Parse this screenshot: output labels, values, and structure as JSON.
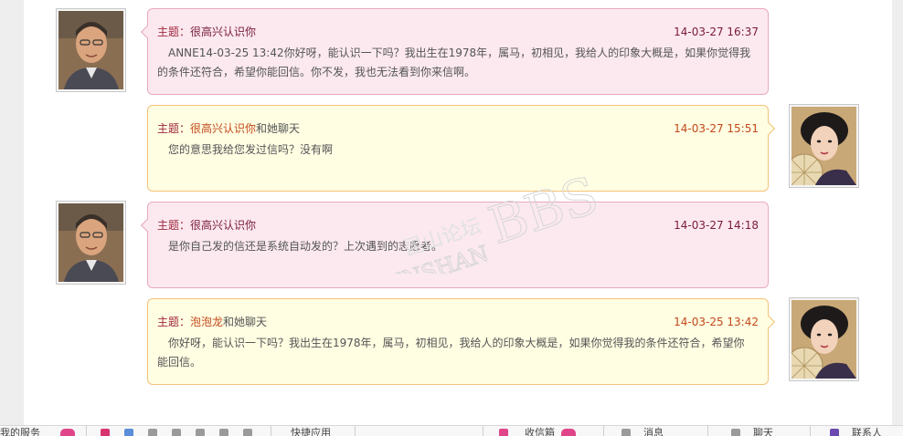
{
  "messages": [
    {
      "side": "left",
      "style": "pink",
      "subject_label": "主题：",
      "topic": "很高兴认识你",
      "suffix": "",
      "time": "14-03-27 16:37",
      "body": "ANNE14-03-25 13:42你好呀，能认识一下吗？我出生在1978年，属马，初相见，我给人的印象大概是，如果你觉得我的条件还符合，希望你能回信。你不发，我也无法看到你来信啊。",
      "avatar": "male-avatar"
    },
    {
      "side": "right",
      "style": "yellow",
      "subject_label": "主题：",
      "topic": "很高兴认识你",
      "suffix": "和她聊天",
      "time": "14-03-27 15:51",
      "body": "您的意思我给您发过信吗？没有啊",
      "avatar": "female-avatar"
    },
    {
      "side": "left",
      "style": "pink",
      "subject_label": "主题：",
      "topic": "很高兴认识你",
      "suffix": "",
      "time": "14-03-27 14:18",
      "body": "是你自己发的信还是系统自动发的？上次遇到的志愿者。",
      "avatar": "male-avatar"
    },
    {
      "side": "right",
      "style": "yellow",
      "subject_label": "主题：",
      "topic": "泡泡龙",
      "suffix": "和她聊天",
      "time": "14-03-25 13:42",
      "body": "你好呀，能认识一下吗？我出生在1978年，属马，初相见，我给人的印象大概是，如果你觉得我的条件还符合，希望你能回信。",
      "avatar": "female-avatar"
    }
  ],
  "watermark": {
    "line1": "昆山论坛",
    "line2": "KUNSHAN",
    "line3": "BBS"
  },
  "bottom_bar": {
    "items": [
      "我的服务",
      "快捷应用",
      "收信箱",
      "消息",
      "聊天",
      "联系人"
    ]
  },
  "colors": {
    "pink_bg": "#fbe9ef",
    "pink_border": "#e9a9bd",
    "yellow_bg": "#fffde2",
    "yellow_border": "#f2c279",
    "topic_dark": "#7a1a3a",
    "topic_orange": "#c2491a"
  }
}
